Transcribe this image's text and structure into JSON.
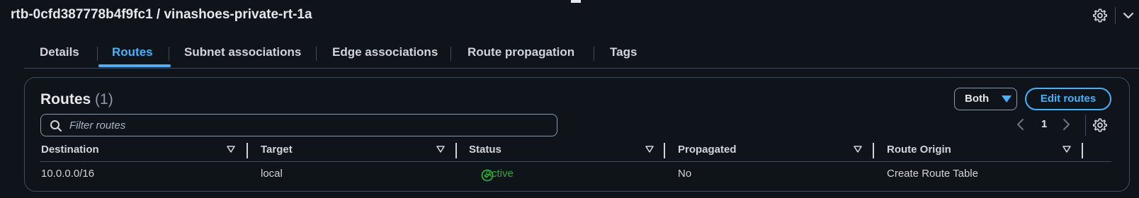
{
  "header": {
    "title": "rtb-0cfd387778b4f9fc1 / vinashoes-private-rt-1a"
  },
  "tabs": [
    {
      "label": "Details",
      "active": false
    },
    {
      "label": "Routes",
      "active": true
    },
    {
      "label": "Subnet associations",
      "active": false
    },
    {
      "label": "Edge associations",
      "active": false
    },
    {
      "label": "Route propagation",
      "active": false
    },
    {
      "label": "Tags",
      "active": false
    }
  ],
  "routes_panel": {
    "heading": "Routes",
    "count": "(1)",
    "filter_placeholder": "Filter routes",
    "ip_filter_selected": "Both",
    "edit_button_label": "Edit routes",
    "page_number": "1"
  },
  "table": {
    "columns": [
      "Destination",
      "Target",
      "Status",
      "Propagated",
      "Route Origin"
    ],
    "rows": [
      {
        "destination": "10.0.0.0/16",
        "target": "local",
        "status": "Active",
        "propagated": "No",
        "route_origin": "Create Route Table"
      }
    ]
  },
  "icons": {
    "settings": "gear-icon",
    "collapse": "chevron-down-icon",
    "search": "search-icon",
    "dropdown": "caret-down-icon",
    "prev": "chevron-left-icon",
    "next": "chevron-right-icon",
    "sort": "sort-down-icon",
    "status": "check-circle-icon"
  },
  "colors": {
    "accent": "#42b4ff",
    "success": "#29ad32",
    "background": "#0f141a",
    "border": "#414d5c"
  }
}
